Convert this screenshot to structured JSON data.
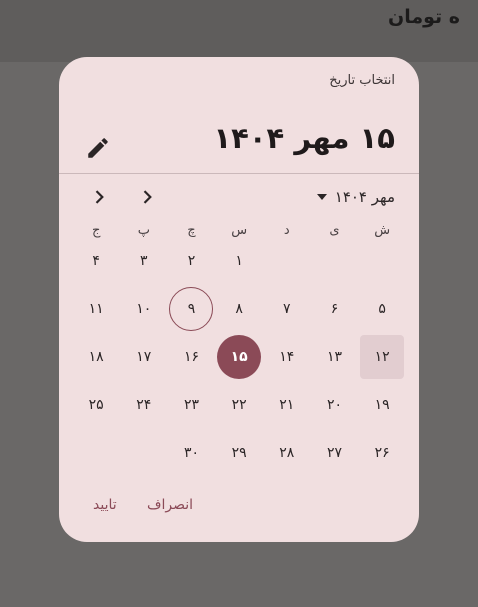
{
  "background_title": "ه تومان",
  "dialog": {
    "heading": "انتخاب تاریخ",
    "selected_date": "۱۵ مهر ۱۴۰۴",
    "month_year": "مهر ۱۴۰۴",
    "edit_icon": "pencil-icon",
    "prev_icon": "chevron-left-icon",
    "next_icon": "chevron-right-icon",
    "weekdays": [
      "ش",
      "ی",
      "د",
      "س",
      "چ",
      "پ",
      "ج"
    ],
    "days": [
      "۱",
      "۲",
      "۳",
      "۴",
      "۵",
      "۶",
      "۷",
      "۸",
      "۹",
      "۱۰",
      "۱۱",
      "۱۲",
      "۱۳",
      "۱۴",
      "۱۵",
      "۱۶",
      "۱۷",
      "۱۸",
      "۱۹",
      "۲۰",
      "۲۱",
      "۲۲",
      "۲۳",
      "۲۴",
      "۲۵",
      "۲۶",
      "۲۷",
      "۲۸",
      "۲۹",
      "۳۰"
    ],
    "first_day_column": 3,
    "today_day": "۹",
    "selected_day": "۱۵",
    "highlighted_day": "۱۲",
    "cancel_label": "انصراف",
    "ok_label": "تایید"
  },
  "colors": {
    "surface": "#f1dfe0",
    "primary": "#8b4a57",
    "scrim": "#6a6867"
  }
}
